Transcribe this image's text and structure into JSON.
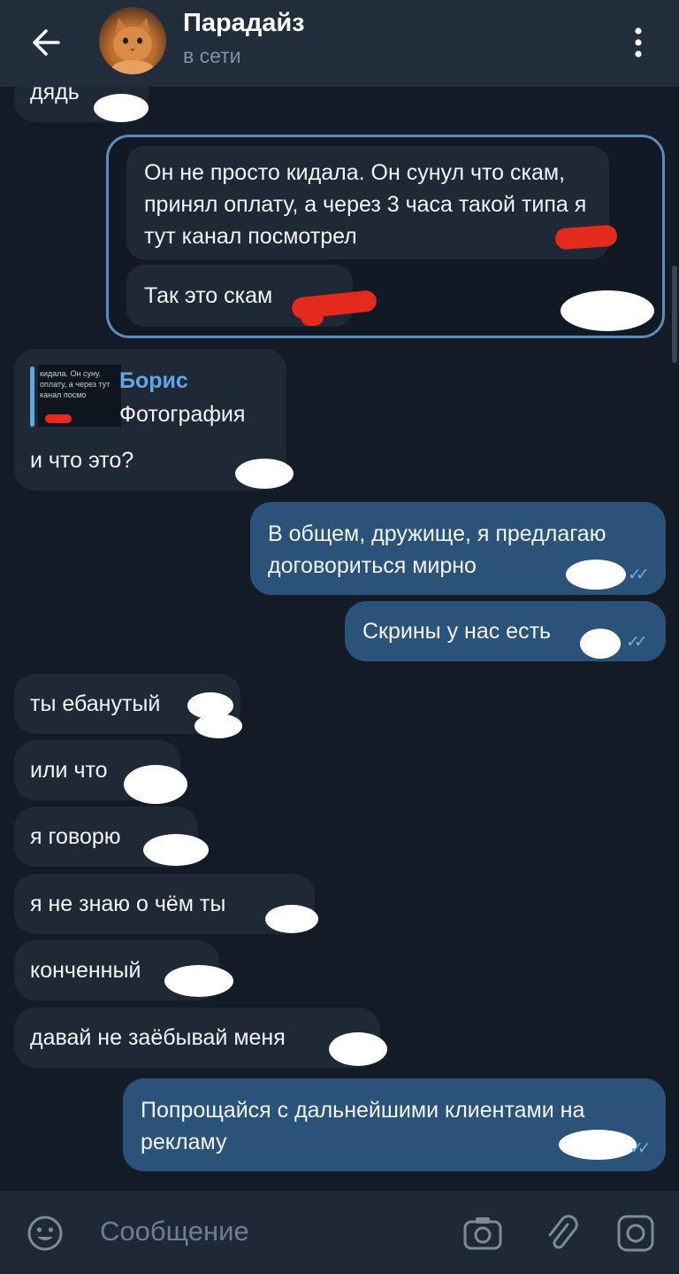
{
  "header": {
    "title": "Парадайз",
    "status": "в сети"
  },
  "messages": {
    "partial": "дядь",
    "fwd1": "Он не просто кидала. Он сунул что скам, принял оплату, а через 3 часа такой типа я тут канал посмотрел",
    "fwd2": "Так это скам",
    "reply_author": "Борис",
    "reply_type": "Фотография",
    "reply_thumb_text": "кидала. Он суну. оплату, а через тут канал посмо",
    "m_what": "и что это?",
    "m_out1": "В общем, дружище, я предлагаю договориться мирно",
    "m_out2": "Скрины у нас есть",
    "m_in1": "ты ебанутый",
    "m_in2": "или что",
    "m_in3": "я говорю",
    "m_in4": "я не знаю о чём ты",
    "m_in5": "конченный",
    "m_in6": "давай не заёбывай меня",
    "m_out3": "Попрощайся с дальнейшими клиентами на рекламу"
  },
  "input": {
    "placeholder": "Сообщение"
  },
  "icons": {
    "back": "arrow-left-icon",
    "menu": "more-vertical-icon",
    "emoji": "emoji-icon",
    "camera": "camera-icon",
    "attach": "paperclip-icon",
    "video": "video-message-icon"
  },
  "colors": {
    "background": "#121b26",
    "header": "#212d3b",
    "incoming_bubble": "#1f2936",
    "outgoing_bubble": "#2b5278",
    "accent": "#5ea8e6",
    "read_check": "#68b0ea"
  }
}
